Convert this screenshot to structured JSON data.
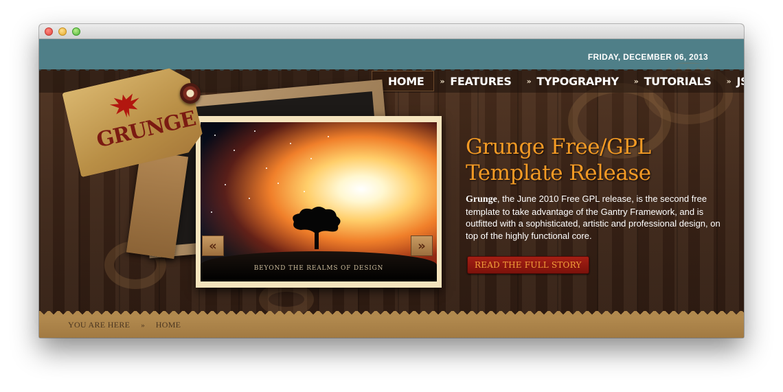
{
  "header": {
    "date": "FRIDAY, DECEMBER 06, 2013"
  },
  "logo": {
    "text": "GRUNGE",
    "icon": "eagle-icon"
  },
  "nav": {
    "items": [
      {
        "label": "HOME",
        "active": true
      },
      {
        "label": "FEATURES",
        "active": false
      },
      {
        "label": "TYPOGRAPHY",
        "active": false
      },
      {
        "label": "TUTORIALS",
        "active": false
      },
      {
        "label": "JSTUFF",
        "active": false
      }
    ],
    "separator": "»"
  },
  "slideshow": {
    "caption": "BEYOND THE REALMS OF DESIGN",
    "prev_label": "«",
    "next_label": "»"
  },
  "feature": {
    "title": "Grunge Free/GPL Template Release",
    "body_strong": "Grunge",
    "body": ", the June 2010 Free GPL release, is the second free template to take advantage of the Gantry Framework, and is outfitted with a sophisticated, artistic and professional design, on top of the highly functional core.",
    "button_label": "READ THE FULL STORY"
  },
  "breadcrumb": {
    "prefix": "YOU ARE HERE",
    "separator": "»",
    "current": "HOME"
  },
  "colors": {
    "topbar": "#4f7f88",
    "accent": "#f39a25",
    "button": "#a51f14",
    "bottombar": "#b28a4f"
  }
}
